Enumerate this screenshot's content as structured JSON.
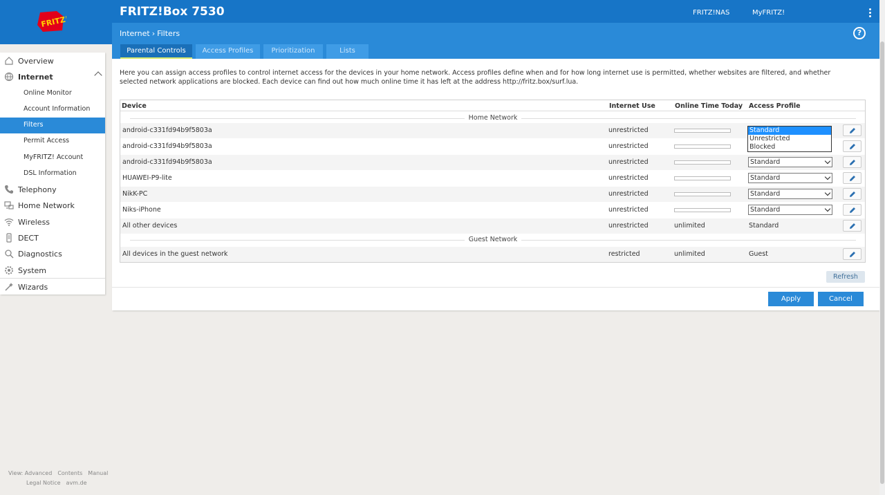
{
  "header": {
    "product": "FRITZ!Box 7530",
    "links": [
      "FRITZ!NAS",
      "MyFRITZ!"
    ]
  },
  "breadcrumb": {
    "parent": "Internet",
    "current": "Filters"
  },
  "tabs": [
    "Parental Controls",
    "Access Profiles",
    "Prioritization",
    "Lists"
  ],
  "sidebar": {
    "items": [
      {
        "label": "Overview",
        "icon": "home-icon"
      },
      {
        "label": "Internet",
        "icon": "globe-icon"
      },
      {
        "label": "Online Monitor"
      },
      {
        "label": "Account Information"
      },
      {
        "label": "Filters"
      },
      {
        "label": "Permit Access"
      },
      {
        "label": "MyFRITZ! Account"
      },
      {
        "label": "DSL Information"
      },
      {
        "label": "Telephony",
        "icon": "phone-icon"
      },
      {
        "label": "Home Network",
        "icon": "network-icon"
      },
      {
        "label": "Wireless",
        "icon": "wifi-icon"
      },
      {
        "label": "DECT",
        "icon": "dect-icon"
      },
      {
        "label": "Diagnostics",
        "icon": "diagnostics-icon"
      },
      {
        "label": "System",
        "icon": "system-icon"
      },
      {
        "label": "Wizards",
        "icon": "wizards-icon"
      }
    ]
  },
  "intro": "Here you can assign access profiles to control internet access for the devices in your home network. Access profiles define when and for how long internet use is permitted, whether websites are filtered, and whether selected network applications are blocked. Each device can find out how much online time it has left at the address http://fritz.box/surf.lua.",
  "table": {
    "columns": [
      "Device",
      "Internet Use",
      "Online Time Today",
      "Access Profile"
    ],
    "groups": [
      "Home Network",
      "Guest Network"
    ],
    "rows": [
      {
        "device": "android-c331fd94b9f5803a",
        "use": "unrestricted",
        "time": "",
        "profile": "Standard"
      },
      {
        "device": "android-c331fd94b9f5803a",
        "use": "unrestricted",
        "time": "",
        "profile": "Standard"
      },
      {
        "device": "android-c331fd94b9f5803a",
        "use": "unrestricted",
        "time": "",
        "profile": "Standard"
      },
      {
        "device": "HUAWEI-P9-lite",
        "use": "unrestricted",
        "time": "",
        "profile": "Standard"
      },
      {
        "device": "NikK-PC",
        "use": "unrestricted",
        "time": "",
        "profile": "Standard"
      },
      {
        "device": "Niks-iPhone",
        "use": "unrestricted",
        "time": "",
        "profile": "Standard"
      },
      {
        "device": "All other devices",
        "use": "unrestricted",
        "time": "unlimited",
        "profile": "Standard"
      },
      {
        "device": "All devices in the guest network",
        "use": "restricted",
        "time": "unlimited",
        "profile": "Guest"
      }
    ],
    "dropdown_options": [
      "Standard",
      "Unrestricted",
      "Blocked"
    ]
  },
  "buttons": {
    "refresh": "Refresh",
    "apply": "Apply",
    "cancel": "Cancel"
  },
  "footer": {
    "line1": [
      "View: Advanced",
      "Contents",
      "Manual"
    ],
    "line2": [
      "Legal Notice",
      "avm.de"
    ]
  },
  "colors": {
    "brand_blue": "#1775c7",
    "accent_blue": "#2a8ad8",
    "tab_underline": "#d8e96b"
  }
}
